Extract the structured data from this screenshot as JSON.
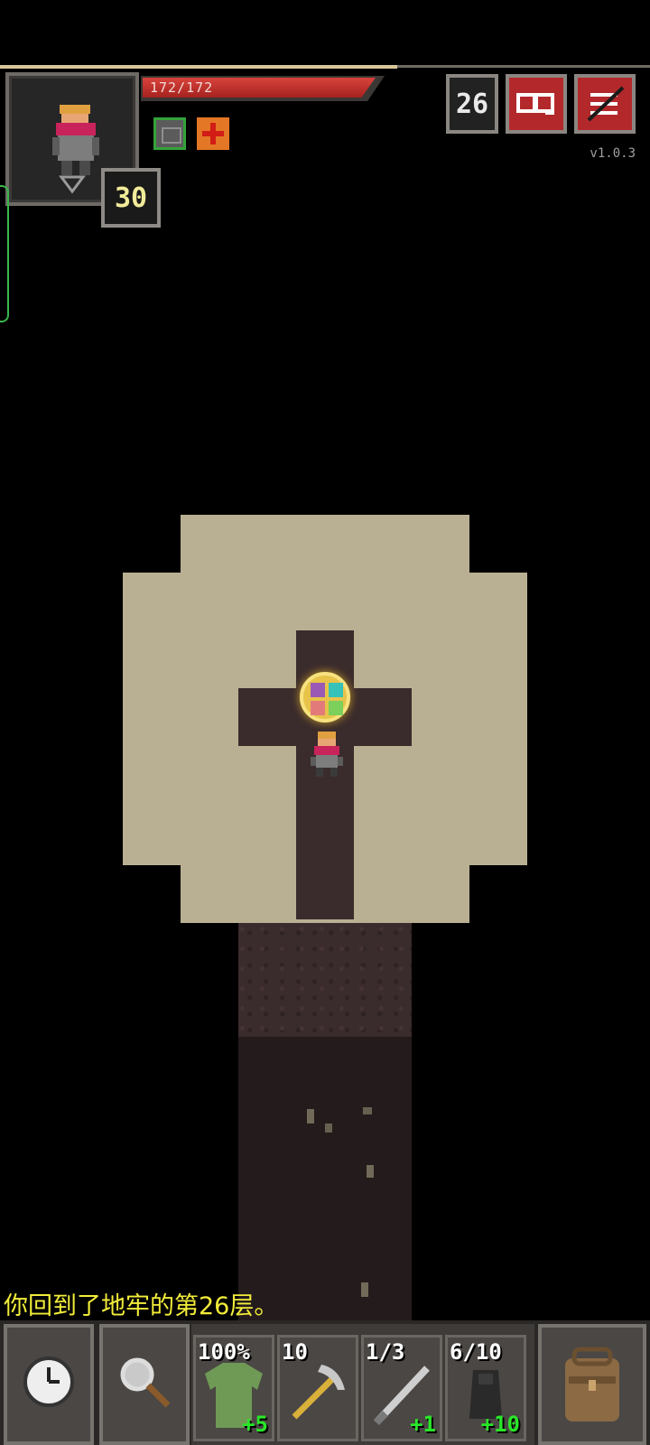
{
  "status": {
    "hp_text": "172/172",
    "hp_fraction": 1.0,
    "level": "30",
    "depth": "26",
    "version": "v1.0.3"
  },
  "buffs": [
    {
      "icon": "armor-buff-icon"
    },
    {
      "icon": "healing-buff-icon"
    }
  ],
  "log": {
    "message": "你回到了地牢的第26层。"
  },
  "quickslots": [
    {
      "top": "100%",
      "bottom": "+5",
      "icon": "armor-icon"
    },
    {
      "top": "10",
      "bottom": "",
      "icon": "pickaxe-icon"
    },
    {
      "top": "1/3",
      "bottom": "+1",
      "icon": "sword-icon"
    },
    {
      "top": "6/10",
      "bottom": "+10",
      "icon": "cloak-icon"
    }
  ],
  "colors": {
    "hp": "#c0302a",
    "log": "#f2ec3a",
    "upgrade": "#29e629",
    "menu_buttons": "#b3292b"
  }
}
